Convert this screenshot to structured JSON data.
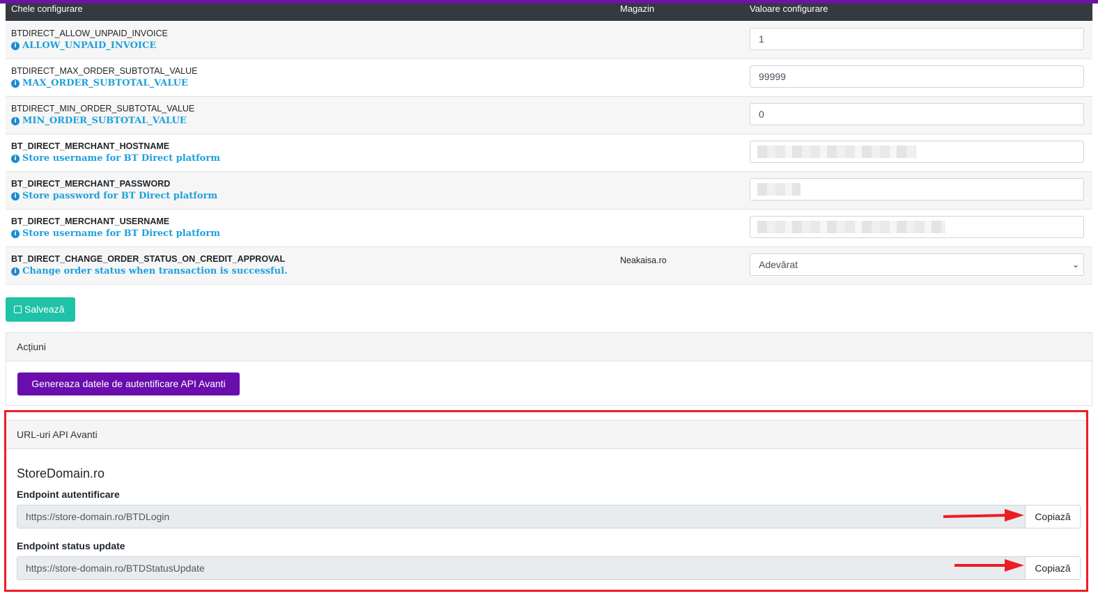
{
  "header": {
    "key_col": "Chele configurare",
    "store_col": "Magazin",
    "value_col": "Valoare configurare"
  },
  "rows": [
    {
      "key": "BTDIRECT_ALLOW_UNPAID_INVOICE",
      "desc": "ALLOW_UNPAID_INVOICE",
      "store": "",
      "value": "1"
    },
    {
      "key": "BTDIRECT_MAX_ORDER_SUBTOTAL_VALUE",
      "desc": "MAX_ORDER_SUBTOTAL_VALUE",
      "store": "",
      "value": "99999"
    },
    {
      "key": "BTDIRECT_MIN_ORDER_SUBTOTAL_VALUE",
      "desc": "MIN_ORDER_SUBTOTAL_VALUE",
      "store": "",
      "value": "0"
    },
    {
      "key": "BT_DIRECT_MERCHANT_HOSTNAME",
      "desc": "Store username for BT Direct platform",
      "store": "",
      "value": ""
    },
    {
      "key": "BT_DIRECT_MERCHANT_PASSWORD",
      "desc": "Store password for BT Direct platform",
      "store": "",
      "value": ""
    },
    {
      "key": "BT_DIRECT_MERCHANT_USERNAME",
      "desc": "Store username for BT Direct platform",
      "store": "",
      "value": ""
    },
    {
      "key": "BT_DIRECT_CHANGE_ORDER_STATUS_ON_CREDIT_APPROVAL",
      "desc": "Change order status when transaction is successful.",
      "store": "Neakaisa.ro",
      "value": "Adevărat"
    }
  ],
  "info_icon": "info-circle-icon",
  "save_button": {
    "label": "Salvează",
    "icon": "save-icon"
  },
  "actions": {
    "title": "Acțiuni",
    "generate_button": "Genereaza datele de autentificare API Avanti"
  },
  "api_urls": {
    "title": "URL-uri API Avanti",
    "domain": "StoreDomain.ro",
    "auth_label": "Endpoint autentificare",
    "auth_url": "https://store-domain.ro/BTDLogin",
    "status_label": "Endpoint status update",
    "status_url": "https://store-domain.ro/BTDStatusUpdate",
    "copy_label": "Copiază"
  },
  "colors": {
    "accent_purple": "#6a0dad",
    "save_green": "#1ec2a6",
    "desc_blue": "#1ea0dc",
    "highlight_red": "#ee1c24"
  }
}
